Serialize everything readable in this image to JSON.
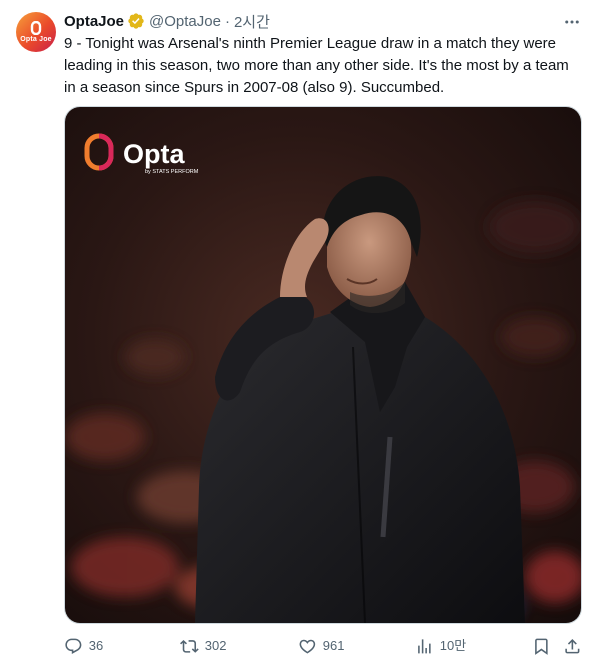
{
  "tweet": {
    "author": {
      "display_name": "OptaJoe",
      "handle": "@OptaJoe",
      "time": "2시간",
      "avatar_text": "Opta Joe"
    },
    "text": "9 - Tonight was Arsenal's ninth Premier League draw in a match they were leading in this season, two more than any other side. It's the most by a team in a season since Spurs in 2007-08 (also 9). Succumbed.",
    "media": {
      "logo_text": "Opta",
      "logo_subtext": "by STATS PERFORM"
    },
    "actions": {
      "replies": "36",
      "reposts": "302",
      "likes": "961",
      "views": "10만"
    }
  },
  "colors": {
    "text_primary": "#0f1419",
    "text_secondary": "#536471",
    "verified_gold": "#e2b719",
    "border": "#cfd9de"
  },
  "icons": [
    "more-icon",
    "verified-badge-icon",
    "reply-icon",
    "repost-icon",
    "like-icon",
    "views-icon",
    "bookmark-icon",
    "share-icon"
  ]
}
